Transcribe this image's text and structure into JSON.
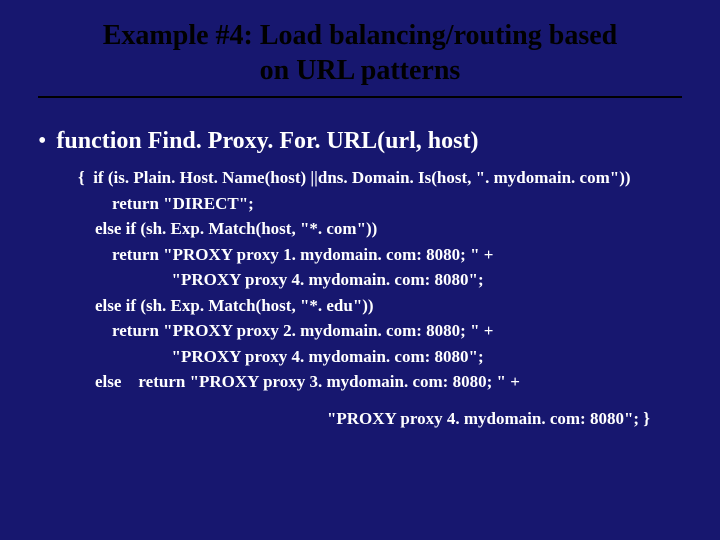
{
  "title_line1": "Example #4: Load balancing/routing based",
  "title_line2": "on URL patterns",
  "bullet_dot": "•",
  "bullet_text": "function Find. Proxy. For. URL(url, host)",
  "code": "{  if (is. Plain. Host. Name(host) ||dns. Domain. Is(host, \". mydomain. com\"))\n        return \"DIRECT\";\n    else if (sh. Exp. Match(host, \"*. com\"))\n        return \"PROXY proxy 1. mydomain. com: 8080; \" +\n                      \"PROXY proxy 4. mydomain. com: 8080\";\n    else if (sh. Exp. Match(host, \"*. edu\"))\n        return \"PROXY proxy 2. mydomain. com: 8080; \" +\n                      \"PROXY proxy 4. mydomain. com: 8080\";\n    else    return \"PROXY proxy 3. mydomain. com: 8080; \" +",
  "code_tail": "\"PROXY proxy 4. mydomain. com: 8080\";    }"
}
